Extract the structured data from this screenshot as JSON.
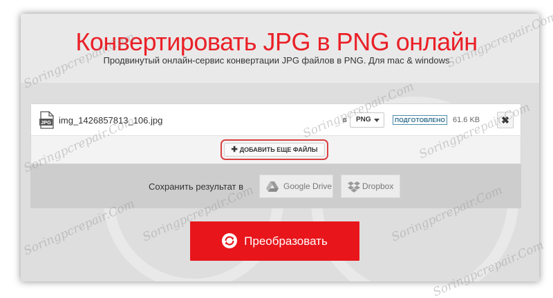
{
  "header": {
    "title": "Конвертировать JPG в PNG онлайн",
    "subtitle": "Продвинутый онлайн-сервис конвертации JPG файлов в PNG. Для mac & windows"
  },
  "file": {
    "type_icon_label": "JPG",
    "name": "img_1426857813_106.jpg",
    "in_label": "в",
    "format": "PNG",
    "status": "ПОДГОТОВЛЕНО",
    "size": "61.6 KB",
    "remove_glyph": "✖"
  },
  "add_files": {
    "plus_glyph": "✚",
    "label": "ДОБАВИТЬ ЕЩЕ ФАЙЛЫ"
  },
  "save": {
    "label": "Сохранить результат в",
    "google_drive_label": "Google Drive",
    "dropbox_label": "Dropbox"
  },
  "convert": {
    "label": "Преобразовать"
  },
  "watermark": {
    "text": "Soringpcrepair.Com"
  },
  "colors": {
    "accent": "#e8151b",
    "status": "#2f6f8f"
  }
}
